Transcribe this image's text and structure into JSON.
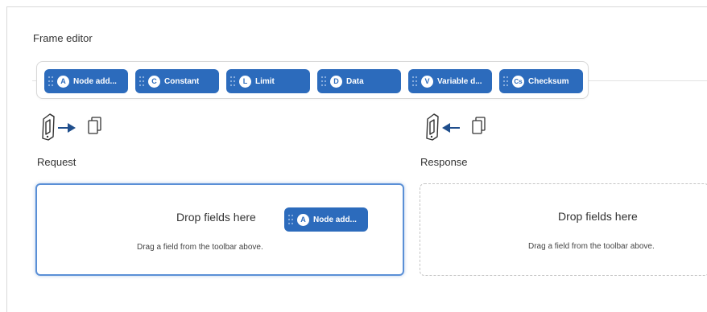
{
  "editor": {
    "title": "Frame editor"
  },
  "toolbar": {
    "chips": [
      {
        "badge": "A",
        "label": "Node add..."
      },
      {
        "badge": "C",
        "label": "Constant"
      },
      {
        "badge": "L",
        "label": "Limit"
      },
      {
        "badge": "D",
        "label": "Data"
      },
      {
        "badge": "V",
        "label": "Variable d..."
      },
      {
        "badge": "Cs",
        "label": "Checksum"
      }
    ]
  },
  "request": {
    "label": "Request",
    "drop_title": "Drop fields here",
    "drop_hint": "Drag a field from the toolbar above.",
    "dragged_chip": {
      "badge": "A",
      "label": "Node add..."
    }
  },
  "response": {
    "label": "Response",
    "drop_title": "Drop fields here",
    "drop_hint": "Drag a field from the toolbar above."
  },
  "colors": {
    "accent": "#2c6bbc",
    "arrow": "#1f4e8c",
    "active_border": "#5a8fd6"
  },
  "icons": {
    "request_direction": "device-to-pages-arrow-icon",
    "response_direction": "pages-to-device-arrow-icon",
    "chip_handle": "drag-handle-icon"
  }
}
